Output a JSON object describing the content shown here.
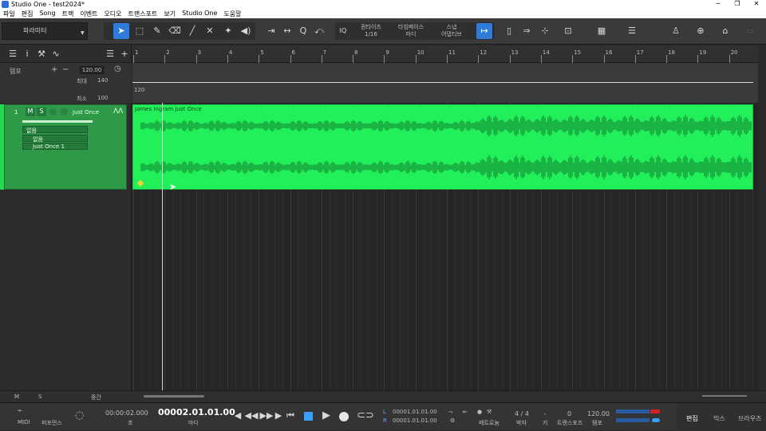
{
  "window": {
    "title": "Studio One - test2024*",
    "controls": [
      "─",
      "❐",
      "✕"
    ]
  },
  "menu": [
    "파일",
    "편집",
    "Song",
    "트랙",
    "이벤트",
    "오디오",
    "트랜스포트",
    "보기",
    "Studio One",
    "도움말"
  ],
  "toolbar": {
    "preset": "파라미터",
    "quantize_label": "퀀타이즈",
    "quantize_value": "1/16",
    "timebase_label": "타임베이스",
    "timebase_value": "마디",
    "snap_label": "스냅",
    "snap_value": "어댑티브",
    "iq_label": "IQ"
  },
  "tempo": {
    "label": "템포",
    "value": "120.00",
    "max_label": "최대",
    "max_value": "140",
    "min_label": "최소",
    "min_value": "100",
    "lane_value": "120"
  },
  "ruler": {
    "bars": [
      "1",
      "2",
      "3",
      "4",
      "5",
      "6",
      "7",
      "8",
      "9",
      "10",
      "11",
      "12",
      "13",
      "14",
      "15",
      "16",
      "17",
      "18",
      "19",
      "20"
    ]
  },
  "track": {
    "number": "1",
    "mute": "M",
    "solo": "S",
    "name": "Just Once",
    "input": "없음",
    "output": "없음",
    "channel": "Just Once 1"
  },
  "clip": {
    "name": "James Ingram Just Once",
    "color": "#22f05a"
  },
  "bottombar": {
    "m": "M",
    "s": "S",
    "size": "중간"
  },
  "transport": {
    "midi": "MIDI",
    "performance": "퍼포먼스",
    "time": "00:00:02.000",
    "time_unit": "초",
    "position": "00002.01.01.00",
    "position_unit": "마디",
    "loop_l": "00001.01.01.00",
    "loop_r": "00001.01.01.00",
    "l_label": "L",
    "r_label": "R",
    "metronome": "메트로놈",
    "signature": "4 / 4",
    "signature_label": "박자",
    "key": "-",
    "key_label": "키",
    "transpose": "0",
    "transpose_label": "트랜스포즈",
    "tempo": "120.00",
    "tempo_label": "템포",
    "tab_edit": "편집",
    "tab_mix": "믹스",
    "tab_browse": "브라우즈"
  }
}
